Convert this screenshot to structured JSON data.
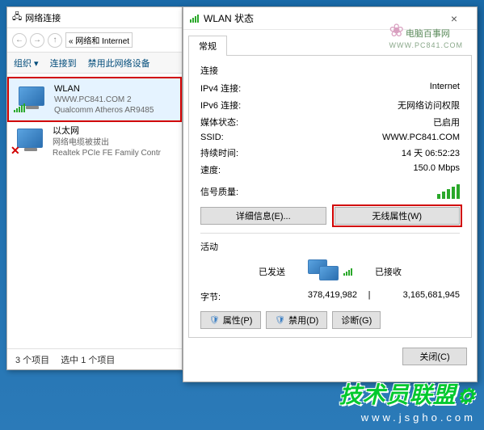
{
  "back": {
    "title": "网络连接",
    "breadcrumb": "« 网络和 Internet",
    "toolbar": {
      "org": "组织 ▾",
      "connectTo": "连接到",
      "disable": "禁用此网络设备"
    },
    "adapters": [
      {
        "name": "WLAN",
        "line2": "WWW.PC841.COM  2",
        "line3": "Qualcomm Atheros AR9485"
      },
      {
        "name": "以太网",
        "line2": "网络电缆被拔出",
        "line3": "Realtek PCIe FE Family Contr"
      }
    ],
    "status": {
      "count": "3 个项目",
      "selected": "选中 1 个项目"
    }
  },
  "front": {
    "title": "WLAN 状态",
    "tab": "常规",
    "conn": {
      "label": "连接",
      "ipv4_l": "IPv4 连接:",
      "ipv4_v": "Internet",
      "ipv6_l": "IPv6 连接:",
      "ipv6_v": "无网络访问权限",
      "media_l": "媒体状态:",
      "media_v": "已启用",
      "ssid_l": "SSID:",
      "ssid_v": "WWW.PC841.COM",
      "dur_l": "持续时间:",
      "dur_v": "14 天 06:52:23",
      "speed_l": "速度:",
      "speed_v": "150.0 Mbps",
      "sig_l": "信号质量:"
    },
    "btn_details": "详细信息(E)...",
    "btn_wireless": "无线属性(W)",
    "activity": {
      "label": "活动",
      "sent": "已发送",
      "recv": "已接收",
      "bytes_l": "字节:",
      "sent_v": "378,419,982",
      "sep": "|",
      "recv_v": "3,165,681,945"
    },
    "btn_props": "属性(P)",
    "btn_disable": "禁用(D)",
    "btn_diag": "诊断(G)",
    "btn_close": "关闭(C)"
  },
  "watermark": {
    "text": "电脑百事网",
    "sub": "WWW.PC841.COM"
  },
  "logo": {
    "main": "技术员联盟",
    "url": "www.jsgho.com"
  }
}
